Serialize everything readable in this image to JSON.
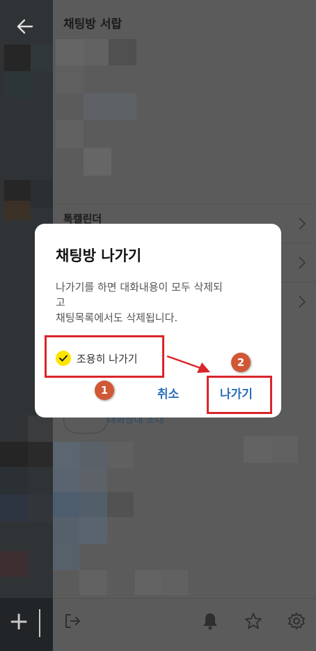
{
  "drawer": {
    "title": "채팅방 서랍",
    "rows": [
      {
        "label": "톡캘린더"
      },
      {
        "label": ""
      },
      {
        "label": ""
      }
    ],
    "invite_label": "대화상대 초대"
  },
  "dialog": {
    "title": "채팅방 나가기",
    "body_lines": [
      "나가기를 하면 대화내용이 모두 삭제되",
      "고",
      "채팅목록에서도 삭제됩니다."
    ],
    "quiet_label": "조용히 나가기",
    "quiet_checked": true,
    "cancel_label": "취소",
    "leave_label": "나가기"
  },
  "annotations": {
    "badge1": "1",
    "badge2": "2",
    "highlight_color": "#d9252a",
    "badge_color": "#d05836"
  },
  "colors": {
    "accent_yellow": "#fee500",
    "button_blue": "#2a6fb8"
  }
}
